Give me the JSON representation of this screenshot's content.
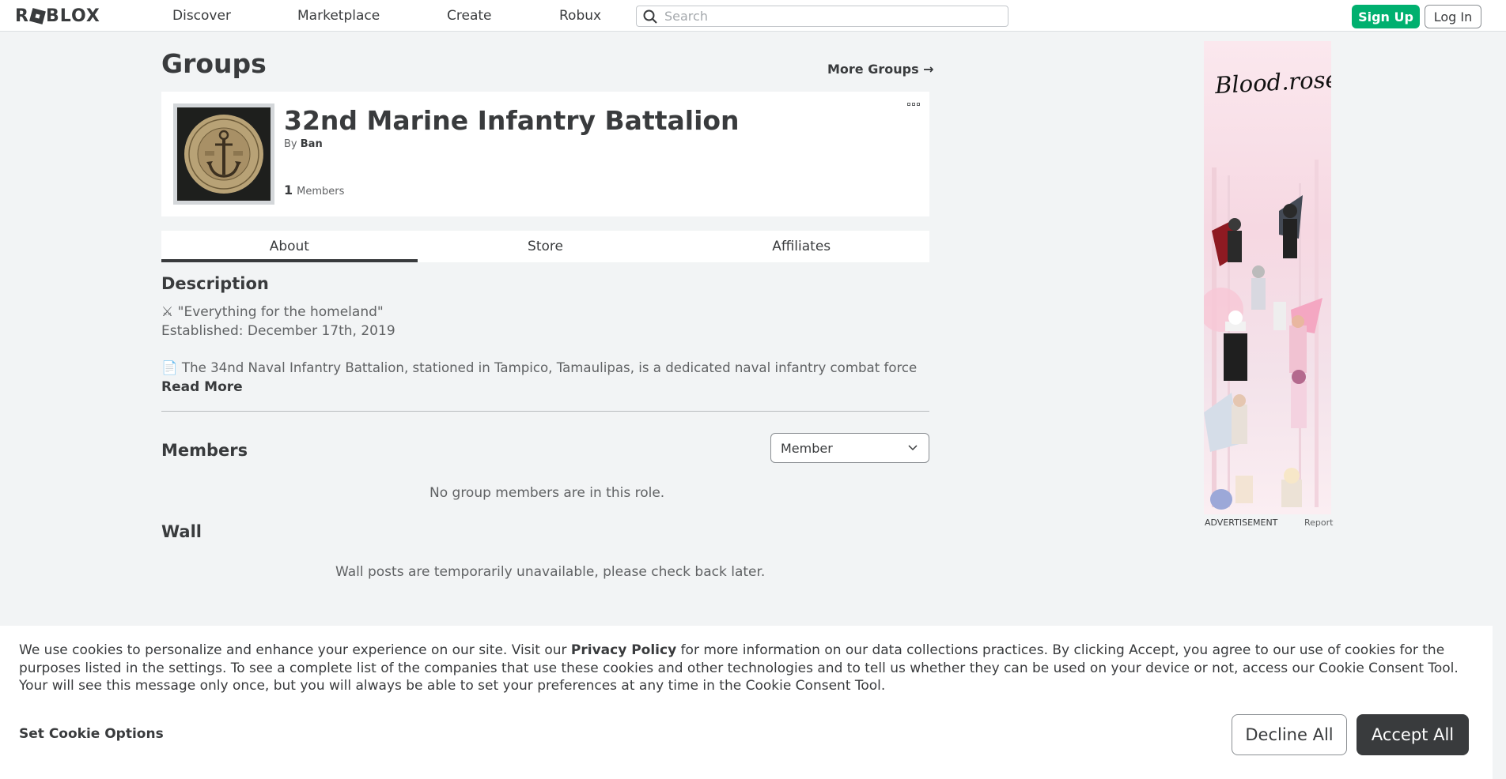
{
  "nav": {
    "logo": "ROBLOX",
    "links": [
      "Discover",
      "Marketplace",
      "Create",
      "Robux"
    ],
    "search_placeholder": "Search",
    "signup_label": "Sign Up",
    "login_label": "Log In"
  },
  "page": {
    "title": "Groups",
    "more_groups": "More Groups →"
  },
  "group": {
    "name": "32nd Marine Infantry Battalion",
    "by_label": "By",
    "owner": "Ban",
    "member_count": "1",
    "members_label": "Members"
  },
  "tabs": [
    "About",
    "Store",
    "Affiliates"
  ],
  "about": {
    "description_heading": "Description",
    "lines": [
      "⚔ \"Everything for the homeland\"",
      "Established: December 17th, 2019",
      "📄 The 34nd Naval Infantry Battalion, stationed in Tampico, Tamaulipas, is a dedicated naval infantry combat force"
    ],
    "read_more": "Read More"
  },
  "members": {
    "heading": "Members",
    "role_selected": "Member",
    "empty_message": "No group members are in this role."
  },
  "wall": {
    "heading": "Wall",
    "message": "Wall posts are temporarily unavailable, please check back later."
  },
  "ad": {
    "brand": "Blood.rose",
    "label": "ADVERTISEMENT",
    "report": "Report"
  },
  "cookie": {
    "text_before": "We use cookies to personalize and enhance your experience on our site. Visit our ",
    "privacy_link": "Privacy Policy",
    "text_after": " for more information on our data collections practices. By clicking Accept, you agree to our use of cookies for the purposes listed in the settings. To see a complete list of the companies that use these cookies and other technologies and to tell us whether they can be used on your device or not, access our Cookie Consent Tool. Your will see this message only once, but you will always be able to set your preferences at any time in the Cookie Consent Tool.",
    "set_options": "Set Cookie Options",
    "decline": "Decline All",
    "accept": "Accept All"
  },
  "colors": {
    "brand_green": "#00b06f",
    "text_dark": "#393b3d",
    "page_bg": "#f2f4f5"
  }
}
